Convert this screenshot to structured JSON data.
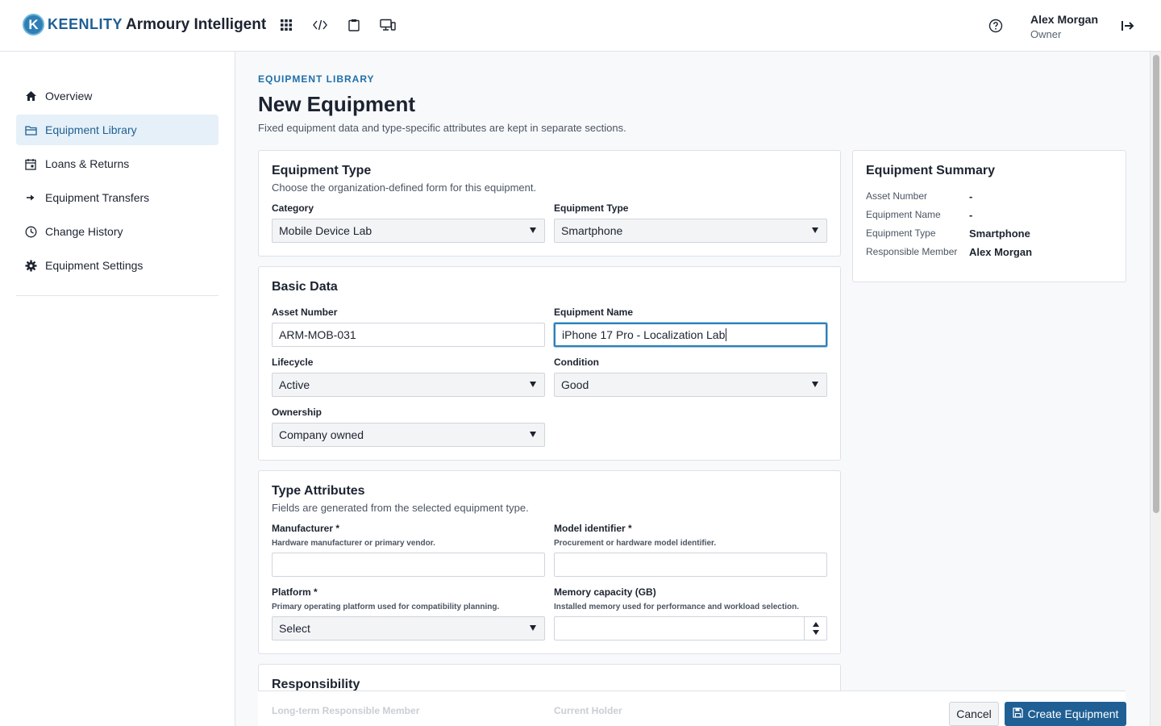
{
  "header": {
    "logo_letter": "K",
    "logo_text": "KEENLITY",
    "app_title": "Armoury Intelligent",
    "user_name": "Alex Morgan",
    "user_role": "Owner"
  },
  "sidebar": {
    "items": [
      {
        "label": "Overview",
        "icon": "home-icon"
      },
      {
        "label": "Equipment Library",
        "icon": "folder-icon"
      },
      {
        "label": "Loans & Returns",
        "icon": "calendar-icon"
      },
      {
        "label": "Equipment Transfers",
        "icon": "arrow-right-icon"
      },
      {
        "label": "Change History",
        "icon": "clock-icon"
      },
      {
        "label": "Equipment Settings",
        "icon": "gear-icon"
      }
    ],
    "active_index": 1
  },
  "page": {
    "eyebrow": "EQUIPMENT LIBRARY",
    "title": "New Equipment",
    "subtitle": "Fixed equipment data and type-specific attributes are kept in separate sections."
  },
  "equipment_type": {
    "title": "Equipment Type",
    "subtitle": "Choose the organization-defined form for this equipment.",
    "category_label": "Category",
    "category_value": "Mobile Device Lab",
    "type_label": "Equipment Type",
    "type_value": "Smartphone"
  },
  "basic_data": {
    "title": "Basic Data",
    "asset_label": "Asset Number",
    "asset_value": "ARM-MOB-031",
    "name_label": "Equipment Name",
    "name_value": "iPhone 17 Pro - Localization Lab",
    "lifecycle_label": "Lifecycle",
    "lifecycle_value": "Active",
    "condition_label": "Condition",
    "condition_value": "Good",
    "ownership_label": "Ownership",
    "ownership_value": "Company owned"
  },
  "type_attributes": {
    "title": "Type Attributes",
    "subtitle": "Fields are generated from the selected equipment type.",
    "manufacturer_label": "Manufacturer *",
    "manufacturer_help": "Hardware manufacturer or primary vendor.",
    "manufacturer_value": "",
    "model_label": "Model identifier *",
    "model_help": "Procurement or hardware model identifier.",
    "model_value": "",
    "platform_label": "Platform *",
    "platform_help": "Primary operating platform used for compatibility planning.",
    "platform_value": "Select",
    "memory_label": "Memory capacity (GB)",
    "memory_help": "Installed memory used for performance and workload selection.",
    "memory_value": ""
  },
  "responsibility": {
    "title": "Responsibility",
    "long_term_label": "Long-term Responsible Member",
    "holder_label": "Current Holder"
  },
  "summary": {
    "title": "Equipment Summary",
    "rows": [
      {
        "label": "Asset Number",
        "value": "-"
      },
      {
        "label": "Equipment Name",
        "value": "-"
      },
      {
        "label": "Equipment Type",
        "value": "Smartphone"
      },
      {
        "label": "Responsible Member",
        "value": "Alex Morgan"
      }
    ]
  },
  "footer": {
    "cancel_label": "Cancel",
    "create_label": "Create Equipment"
  },
  "colors": {
    "accent": "#1f5f94",
    "active_nav_bg": "#e6f0f8"
  }
}
